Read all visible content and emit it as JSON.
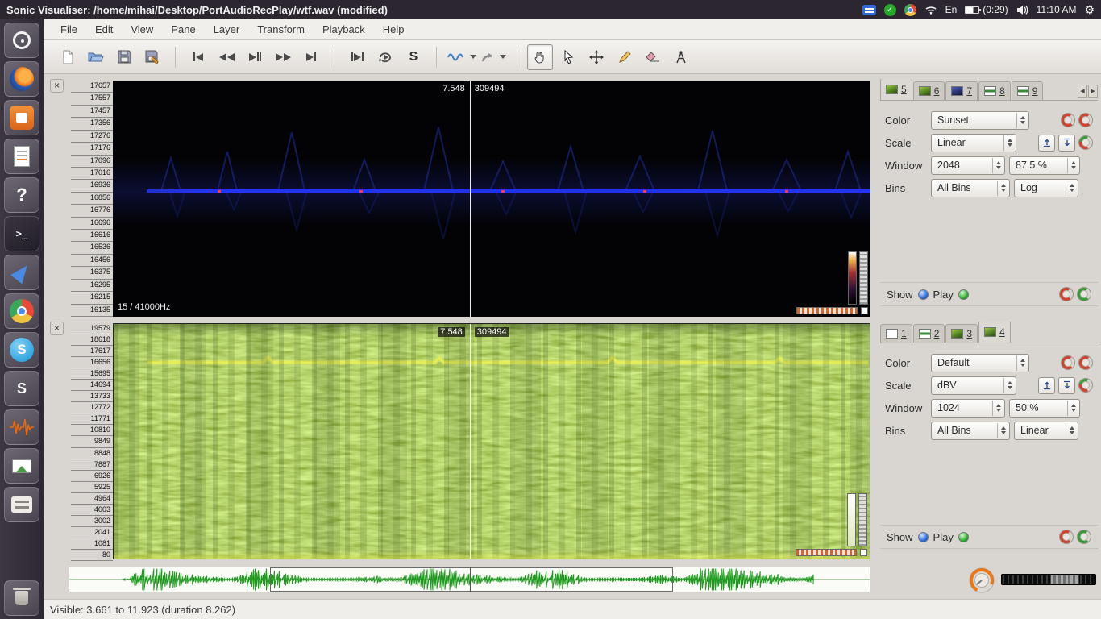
{
  "topbar": {
    "title": "Sonic Visualiser: /home/mihai/Desktop/PortAudioRecPlay/wtf.wav (modified)",
    "language": "En",
    "battery": "(0:29)",
    "clock": "11:10 AM",
    "check_glyph": "✓",
    "gear_glyph": "⚙"
  },
  "launcher": {
    "items": [
      "dash-home",
      "firefox",
      "software-center",
      "text-editor",
      "help",
      "terminal",
      "design-tool",
      "chrome",
      "skype",
      "app-s",
      "sonic-visualiser",
      "image-viewer",
      "archive-manager",
      "trash"
    ]
  },
  "menubar": {
    "items": [
      "File",
      "Edit",
      "View",
      "Pane",
      "Layer",
      "Transform",
      "Playback",
      "Help"
    ]
  },
  "toolbar": {
    "buttons": [
      "new",
      "open",
      "save",
      "save-as",
      "skip-start",
      "rewind",
      "play-pause",
      "fast-forward",
      "skip-end",
      "play-selection",
      "play-loop",
      "solo",
      "playback-scale-dropdown",
      "redo-dropdown",
      "navigate-tool",
      "select-tool",
      "move-tool",
      "draw-tool",
      "erase-tool",
      "measure-tool"
    ],
    "active_tool": "navigate-tool"
  },
  "glyphs": {
    "help": "?",
    "terminal": ">_",
    "skype": "S",
    "app_s": "S",
    "solo": "S",
    "loop": "↻",
    "scroll_left": "◀",
    "scroll_right": "▶"
  },
  "panes": {
    "top": {
      "cursor_time": "7.548",
      "cursor_frame": "309494",
      "info": "15 / 41000Hz",
      "freq_labels": [
        "17657",
        "17557",
        "17457",
        "17356",
        "17276",
        "17176",
        "17096",
        "17016",
        "16936",
        "16856",
        "16776",
        "16696",
        "16616",
        "16536",
        "16456",
        "16375",
        "16295",
        "16215",
        "16135"
      ]
    },
    "bottom": {
      "cursor_time": "7.548",
      "cursor_frame": "309494",
      "freq_labels": [
        "19579",
        "18618",
        "17617",
        "16656",
        "15695",
        "14694",
        "13733",
        "12772",
        "11771",
        "10810",
        "9849",
        "8848",
        "7887",
        "6926",
        "5925",
        "4964",
        "4003",
        "3002",
        "2041",
        "1081",
        "80"
      ]
    }
  },
  "top_box": {
    "tabs": [
      {
        "label": "5"
      },
      {
        "label": "6"
      },
      {
        "label": "7"
      },
      {
        "label": "8"
      },
      {
        "label": "9"
      }
    ],
    "active_tab": "5",
    "color_label": "Color",
    "color_value": "Sunset",
    "scale_label": "Scale",
    "scale_value": "Linear",
    "window_label": "Window",
    "window_value": "2048",
    "window_overlap": "87.5 %",
    "bins_label": "Bins",
    "bins_value": "All Bins",
    "bins_scale": "Log",
    "show_label": "Show",
    "play_label": "Play"
  },
  "bottom_box": {
    "tabs": [
      {
        "label": "1"
      },
      {
        "label": "2"
      },
      {
        "label": "3"
      },
      {
        "label": "4"
      }
    ],
    "active_tab": "4",
    "color_label": "Color",
    "color_value": "Default",
    "scale_label": "Scale",
    "scale_value": "dBV",
    "window_label": "Window",
    "window_value": "1024",
    "window_overlap": "50 %",
    "bins_label": "Bins",
    "bins_value": "All Bins",
    "bins_scale": "Linear",
    "show_label": "Show",
    "play_label": "Play"
  },
  "statusbar": {
    "text": "Visible: 3.661 to 11.923 (duration 8.262)"
  },
  "colors": {
    "topbar_bg": "#2c2630",
    "spectrogram_blue_line": "#2236f2",
    "spectrogram_green": "#79a32c",
    "yellow_line": "#e8ee54",
    "overview_waveform": "#1f9a1f",
    "show_led_blue": "#2e6fe0",
    "play_led_green": "#2fb32f",
    "knob_orange": "#e87818"
  }
}
